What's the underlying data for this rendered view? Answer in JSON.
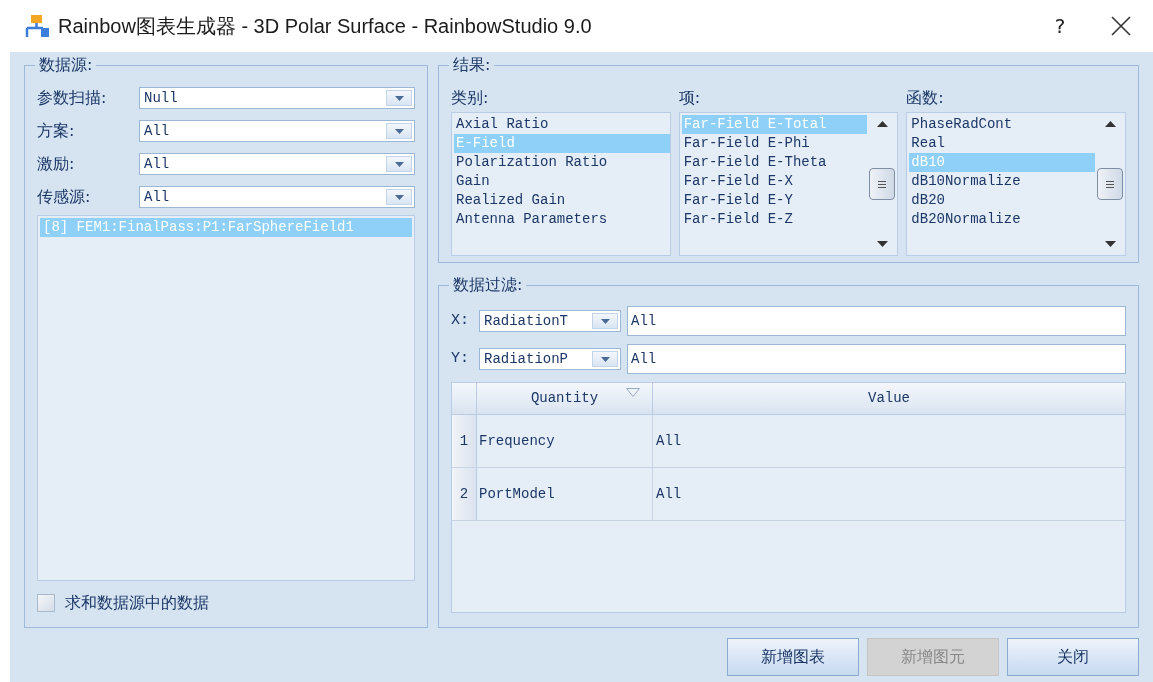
{
  "window": {
    "title": "Rainbow图表生成器 - 3D Polar Surface - RainbowStudio 9.0",
    "help": "?"
  },
  "data_source": {
    "title": "数据源:",
    "fields": [
      {
        "label": "参数扫描:",
        "value": "Null"
      },
      {
        "label": "方案:",
        "value": "All"
      },
      {
        "label": "激励:",
        "value": "All"
      },
      {
        "label": "传感源:",
        "value": "All"
      }
    ],
    "items": [
      {
        "text": "[8] FEM1:FinalPass:P1:FarSphereField1",
        "selected": true
      }
    ],
    "sum_checkbox": {
      "label": "求和数据源中的数据",
      "checked": false
    }
  },
  "results": {
    "title": "结果:",
    "lists": [
      {
        "label": "类别:",
        "scrollbar": false,
        "items": [
          {
            "text": "Axial Ratio",
            "selected": false
          },
          {
            "text": "E-Field",
            "selected": true
          },
          {
            "text": "Polarization Ratio",
            "selected": false
          },
          {
            "text": "Gain",
            "selected": false
          },
          {
            "text": "Realized Gain",
            "selected": false
          },
          {
            "text": "Antenna Parameters",
            "selected": false
          }
        ]
      },
      {
        "label": "项:",
        "scrollbar": true,
        "items": [
          {
            "text": "Far-Field E-Total",
            "selected": true
          },
          {
            "text": "Far-Field E-Phi",
            "selected": false
          },
          {
            "text": "Far-Field E-Theta",
            "selected": false
          },
          {
            "text": "Far-Field E-X",
            "selected": false
          },
          {
            "text": "Far-Field E-Y",
            "selected": false
          },
          {
            "text": "Far-Field E-Z",
            "selected": false
          }
        ]
      },
      {
        "label": "函数:",
        "scrollbar": true,
        "items": [
          {
            "text": "PhaseRadCont",
            "selected": false
          },
          {
            "text": "Real",
            "selected": false
          },
          {
            "text": "dB10",
            "selected": true
          },
          {
            "text": "dB10Normalize",
            "selected": false
          },
          {
            "text": "dB20",
            "selected": false
          },
          {
            "text": "dB20Normalize",
            "selected": false
          }
        ]
      }
    ]
  },
  "filter": {
    "title": "数据过滤:",
    "axes": [
      {
        "label": "X:",
        "variable": "RadiationT",
        "value": "All"
      },
      {
        "label": "Y:",
        "variable": "RadiationP",
        "value": "All"
      }
    ],
    "table": {
      "columns": [
        "Quantity",
        "Value"
      ],
      "rows": [
        {
          "index": "1",
          "quantity": "Frequency",
          "value": "All"
        },
        {
          "index": "2",
          "quantity": "PortModel",
          "value": "All"
        }
      ]
    }
  },
  "buttons": [
    {
      "label": "新增图表",
      "disabled": false
    },
    {
      "label": "新增图元",
      "disabled": true
    },
    {
      "label": "关闭",
      "disabled": false
    }
  ]
}
